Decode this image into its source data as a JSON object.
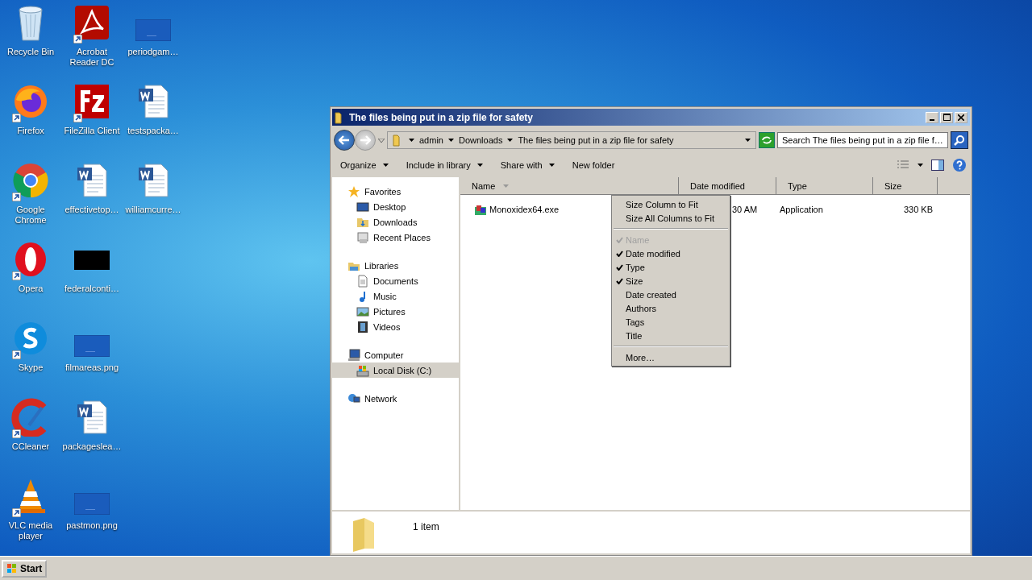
{
  "desktop": {
    "icons": [
      {
        "label": "Recycle Bin",
        "kind": "recycle-bin",
        "shortcut": false
      },
      {
        "label": "Firefox",
        "kind": "firefox",
        "shortcut": true
      },
      {
        "label": "Google Chrome",
        "kind": "chrome",
        "shortcut": true
      },
      {
        "label": "Opera",
        "kind": "opera",
        "shortcut": true
      },
      {
        "label": "Skype",
        "kind": "skype",
        "shortcut": true
      },
      {
        "label": "CCleaner",
        "kind": "ccleaner",
        "shortcut": true
      },
      {
        "label": "VLC media player",
        "kind": "vlc",
        "shortcut": true
      },
      {
        "label": "Acrobat Reader DC",
        "kind": "acrobat",
        "shortcut": true
      },
      {
        "label": "FileZilla Client",
        "kind": "filezilla",
        "shortcut": true
      },
      {
        "label": "effectivetop…",
        "kind": "word",
        "shortcut": false
      },
      {
        "label": "federalconti…",
        "kind": "black-thumb",
        "shortcut": false
      },
      {
        "label": "filmareas.png",
        "kind": "blank-thumb",
        "shortcut": false
      },
      {
        "label": "packageslea…",
        "kind": "word",
        "shortcut": false
      },
      {
        "label": "pastmon.png",
        "kind": "blank-thumb",
        "shortcut": false
      },
      {
        "label": "periodgam…",
        "kind": "blank-thumb",
        "shortcut": false
      },
      {
        "label": "testspacka…",
        "kind": "word",
        "shortcut": false
      },
      {
        "label": "williamcurre…",
        "kind": "word",
        "shortcut": false
      }
    ]
  },
  "window": {
    "title": "The files being put in a zip file for safety"
  },
  "address": {
    "crumbs": [
      "admin",
      "Downloads",
      "The files being put in a zip file for safety"
    ]
  },
  "search": {
    "placeholder": "Search The files being put in a zip file f…"
  },
  "toolbar": {
    "commands": [
      {
        "label": "Organize",
        "menu": true
      },
      {
        "label": "Include in library",
        "menu": true
      },
      {
        "label": "Share with",
        "menu": true
      },
      {
        "label": "New folder",
        "menu": false
      }
    ]
  },
  "navigation": {
    "groups": [
      {
        "label": "Favorites",
        "kind": "star",
        "children": [
          {
            "label": "Desktop",
            "kind": "desktop",
            "selected": false
          },
          {
            "label": "Downloads",
            "kind": "downloads",
            "selected": false
          },
          {
            "label": "Recent Places",
            "kind": "recent",
            "selected": false
          }
        ]
      },
      {
        "label": "Libraries",
        "kind": "libraries",
        "children": [
          {
            "label": "Documents",
            "kind": "documents",
            "selected": false
          },
          {
            "label": "Music",
            "kind": "music",
            "selected": false
          },
          {
            "label": "Pictures",
            "kind": "pictures",
            "selected": false
          },
          {
            "label": "Videos",
            "kind": "videos",
            "selected": false
          }
        ]
      },
      {
        "label": "Computer",
        "kind": "computer",
        "children": [
          {
            "label": "Local Disk (C:)",
            "kind": "disk",
            "selected": true
          }
        ]
      },
      {
        "label": "Network",
        "kind": "network"
      }
    ]
  },
  "table": {
    "columns": [
      {
        "label": "Name",
        "sorted": true
      },
      {
        "label": "Date modified",
        "sorted": false
      },
      {
        "label": "Type",
        "sorted": false
      },
      {
        "label": "Size",
        "sorted": false
      }
    ],
    "rows": [
      {
        "name": "Monoxidex64.exe",
        "date_modified": "30 AM",
        "type": "Application",
        "size": "330 KB"
      }
    ]
  },
  "context_menu": {
    "items": [
      {
        "kind": "action",
        "label": "Size Column to Fit"
      },
      {
        "kind": "action",
        "label": "Size All Columns to Fit"
      },
      {
        "kind": "separator"
      },
      {
        "kind": "column",
        "label": "Name",
        "checked": true,
        "disabled": true
      },
      {
        "kind": "column",
        "label": "Date modified",
        "checked": true,
        "disabled": false
      },
      {
        "kind": "column",
        "label": "Type",
        "checked": true,
        "disabled": false
      },
      {
        "kind": "column",
        "label": "Size",
        "checked": true,
        "disabled": false
      },
      {
        "kind": "column",
        "label": "Date created",
        "checked": false,
        "disabled": false
      },
      {
        "kind": "column",
        "label": "Authors",
        "checked": false,
        "disabled": false
      },
      {
        "kind": "column",
        "label": "Tags",
        "checked": false,
        "disabled": false
      },
      {
        "kind": "column",
        "label": "Title",
        "checked": false,
        "disabled": false
      },
      {
        "kind": "separator"
      },
      {
        "kind": "action",
        "label": "More…"
      }
    ]
  },
  "details_pane": {
    "summary": "1 item"
  },
  "taskbar": {
    "start": "Start"
  }
}
